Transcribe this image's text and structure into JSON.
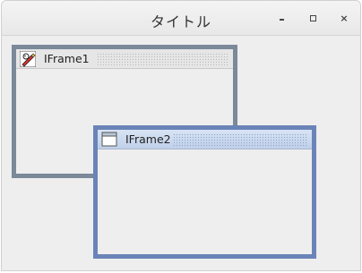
{
  "window": {
    "title": "タイトル",
    "controls": {
      "minimize": "-",
      "maximize": "□",
      "close": "×"
    }
  },
  "internal_frames": [
    {
      "title": "IFrame1",
      "icon": "pencil-duke-icon",
      "active": false
    },
    {
      "title": "IFrame2",
      "icon": "window-icon",
      "active": true
    }
  ],
  "colors": {
    "frame1_border": "#7b8999",
    "frame2_border": "#6a84b8",
    "background": "#eeeeee"
  }
}
